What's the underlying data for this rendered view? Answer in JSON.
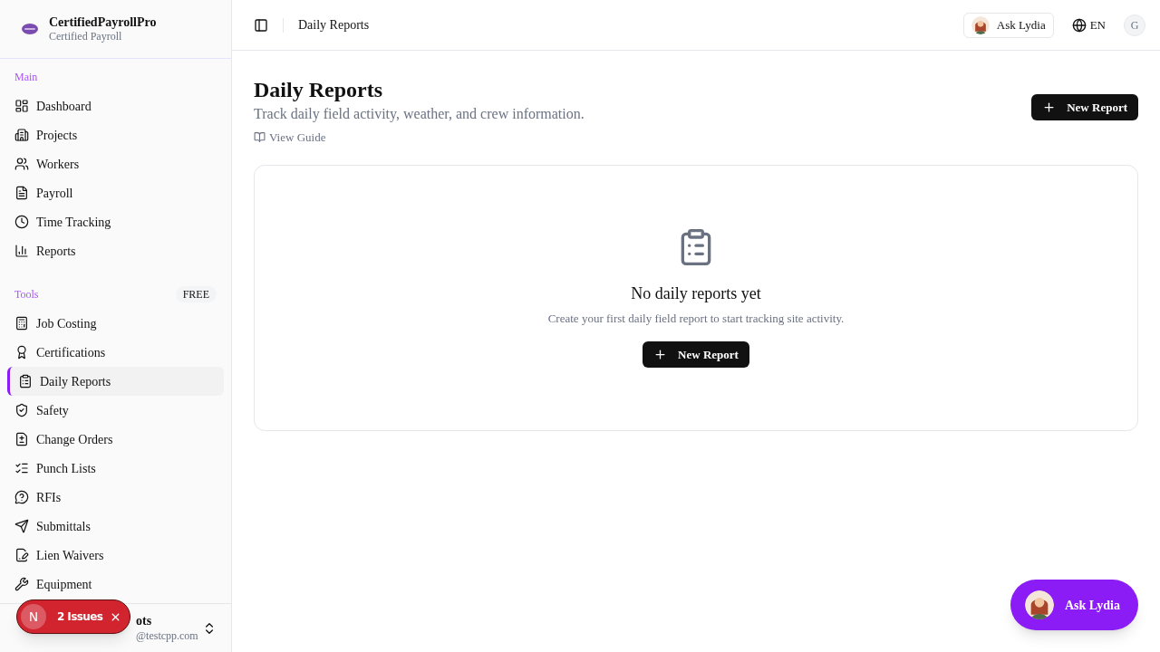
{
  "sidebar": {
    "brand": {
      "name": "CertifiedPayrollPro",
      "subtitle": "Certified Payroll"
    },
    "sections": [
      {
        "label": "Main",
        "items": [
          {
            "label": "Dashboard",
            "selected": false
          },
          {
            "label": "Projects",
            "selected": false
          },
          {
            "label": "Workers",
            "selected": false
          },
          {
            "label": "Payroll",
            "selected": false
          },
          {
            "label": "Time Tracking",
            "selected": false
          },
          {
            "label": "Reports",
            "selected": false
          }
        ]
      },
      {
        "label": "Tools",
        "badge": "FREE",
        "items": [
          {
            "label": "Job Costing",
            "selected": false
          },
          {
            "label": "Certifications",
            "selected": false
          },
          {
            "label": "Daily Reports",
            "selected": true
          },
          {
            "label": "Safety",
            "selected": false
          },
          {
            "label": "Change Orders",
            "selected": false
          },
          {
            "label": "Punch Lists",
            "selected": false
          },
          {
            "label": "RFIs",
            "selected": false
          },
          {
            "label": "Submittals",
            "selected": false
          },
          {
            "label": "Lien Waivers",
            "selected": false
          },
          {
            "label": "Equipment",
            "selected": false
          }
        ]
      }
    ],
    "user": {
      "name": "ots",
      "email": "@testcpp.com"
    }
  },
  "issues_toast": {
    "initial": "N",
    "label": "2 Issues"
  },
  "topbar": {
    "breadcrumb": "Daily Reports",
    "assistant_button": "Ask Lydia",
    "language": "EN",
    "avatar": "G"
  },
  "page": {
    "title": "Daily Reports",
    "subtitle": "Track daily field activity, weather, and crew information.",
    "guide_link": "View Guide",
    "primary_button": "New Report"
  },
  "empty_state": {
    "title": "No daily reports yet",
    "description": "Create your first daily field report to start tracking site activity.",
    "button": "New Report"
  },
  "floating_assistant": {
    "label": "Ask Lydia"
  }
}
